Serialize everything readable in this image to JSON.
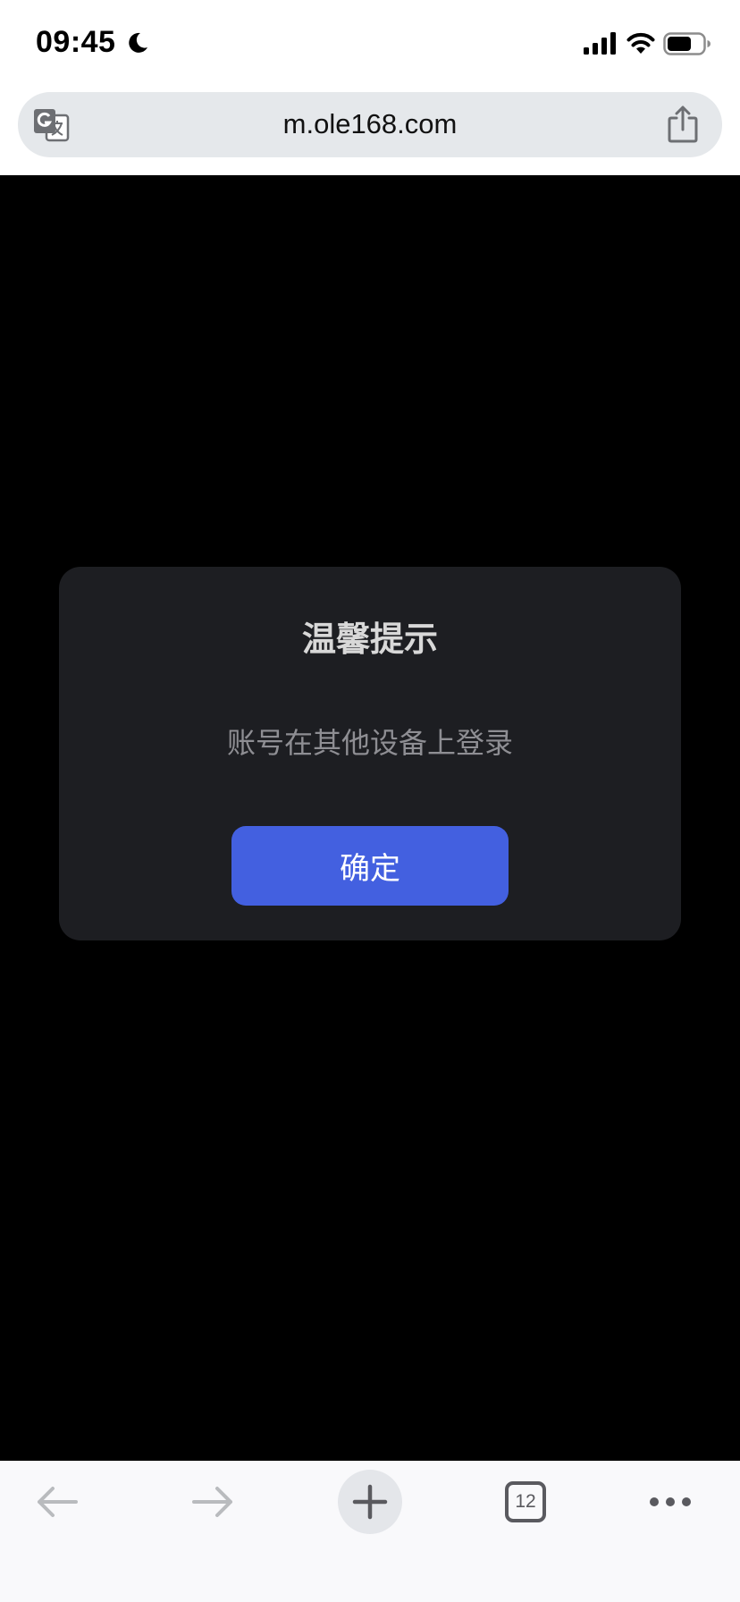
{
  "status_bar": {
    "time": "09:45",
    "icons": [
      "moon-icon",
      "cellular-signal-icon",
      "wifi-icon",
      "battery-icon"
    ]
  },
  "browser": {
    "url": "m.ole168.com",
    "translate_icon": "translate-icon",
    "share_icon": "share-icon"
  },
  "dialog": {
    "title": "温馨提示",
    "message": "账号在其他设备上登录",
    "confirm_label": "确定"
  },
  "toolbar": {
    "back_icon": "arrow-left-icon",
    "forward_icon": "arrow-right-icon",
    "new_tab_icon": "plus-icon",
    "tab_count": "12",
    "more_icon": "ellipsis-icon"
  },
  "colors": {
    "content_bg": "#000000",
    "dialog_bg": "#1d1e22",
    "button_bg": "#4360e0",
    "title_text": "#d8d8d8",
    "message_text": "#8e8e93"
  }
}
